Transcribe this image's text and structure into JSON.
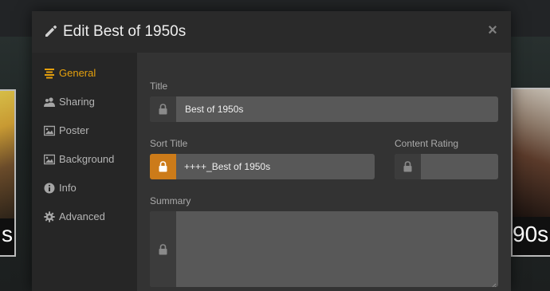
{
  "modal": {
    "title": "Edit Best of 1950s",
    "close_glyph": "×"
  },
  "sidebar": {
    "items": [
      {
        "label": "General",
        "icon": "list-icon",
        "active": true
      },
      {
        "label": "Sharing",
        "icon": "users-icon",
        "active": false
      },
      {
        "label": "Poster",
        "icon": "image-icon",
        "active": false
      },
      {
        "label": "Background",
        "icon": "image-icon",
        "active": false
      },
      {
        "label": "Info",
        "icon": "info-icon",
        "active": false
      },
      {
        "label": "Advanced",
        "icon": "gear-icon",
        "active": false
      }
    ]
  },
  "form": {
    "title": {
      "label": "Title",
      "value": "Best of 1950s",
      "locked": false
    },
    "sort_title": {
      "label": "Sort Title",
      "value": "++++_Best of 1950s",
      "locked": true
    },
    "content_rating": {
      "label": "Content Rating",
      "value": "",
      "locked": false
    },
    "summary": {
      "label": "Summary",
      "value": "",
      "locked": false
    }
  },
  "background": {
    "left_poster_text": "s",
    "right_poster_text": "90s"
  },
  "colors": {
    "accent": "#e5a00d",
    "lock_active": "#cc7b19",
    "field_bg": "#585858",
    "modal_bg": "#333333",
    "sidebar_bg": "#262626"
  }
}
